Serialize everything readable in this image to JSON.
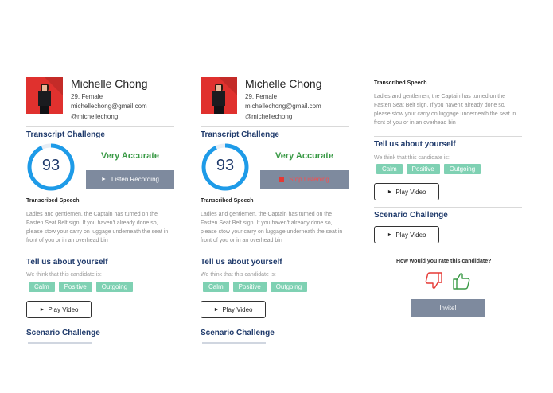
{
  "profile": {
    "name": "Michelle Chong",
    "age_gender": "29, Female",
    "email": "michellechong@gmail.com",
    "handle": "@michellechong"
  },
  "transcript": {
    "title": "Transcript Challenge",
    "score": "93",
    "score_fraction": 0.93,
    "accuracy": "Very Accurate",
    "listen_label": "Listen Recording",
    "stop_label": "Stop Listening",
    "speech_label": "Transcribed Speech",
    "speech_text": "Ladies and gentlemen, the Captain has turned on the Fasten Seat Belt sign. If you haven't already done so, please stow your carry on luggage underneath the seat in front of you or in an overhead bin"
  },
  "about": {
    "title": "Tell us about yourself",
    "hint": "We think that this candidate is:",
    "tags": [
      "Calm",
      "Positive",
      "Outgoing"
    ],
    "play_video_label": "Play Video"
  },
  "scenario": {
    "title": "Scenario Challenge",
    "play_video_label": "Play Video"
  },
  "rating": {
    "question": "How would you rate this candidate?",
    "invite_label": "Invite!"
  },
  "colors": {
    "accent_blue": "#1e9be8",
    "heading_navy": "#1f3a6b",
    "accurate_green": "#3a9a46",
    "tag_green": "#7fd1b3",
    "button_gray": "#7e8a9e",
    "stop_red": "#e53935",
    "avatar_red": "#e0312e"
  },
  "icons": {
    "play": "play-icon",
    "stop": "stop-icon",
    "thumbs_down": "thumbs-down-icon",
    "thumbs_up": "thumbs-up-icon"
  }
}
